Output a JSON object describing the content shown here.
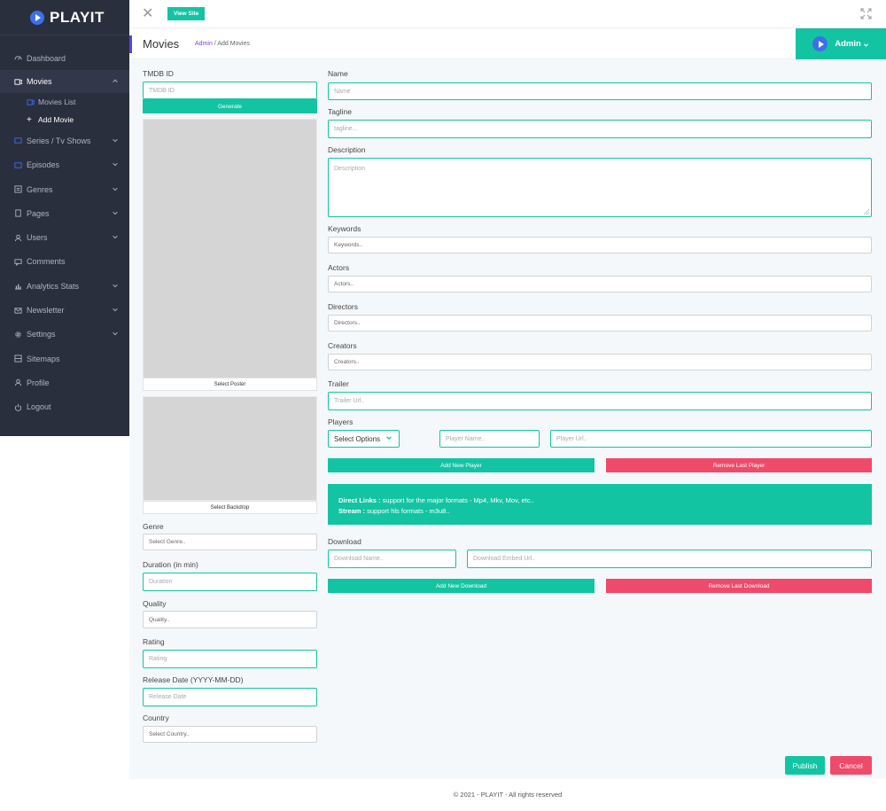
{
  "app": {
    "logo_text": "PLAYIT"
  },
  "sidebar": {
    "items": [
      {
        "label": "Dashboard",
        "icon": "dashboard-icon",
        "chevron": ""
      },
      {
        "label": "Movies",
        "icon": "video-icon",
        "chevron": "^"
      },
      {
        "label": "Series / Tv Shows",
        "icon": "tv-icon",
        "chevron": "v"
      },
      {
        "label": "Episodes",
        "icon": "episodes-icon",
        "chevron": "v"
      },
      {
        "label": "Genres",
        "icon": "genres-icon",
        "chevron": "v"
      },
      {
        "label": "Pages",
        "icon": "pages-icon",
        "chevron": "v"
      },
      {
        "label": "Users",
        "icon": "users-icon",
        "chevron": "v"
      },
      {
        "label": "Comments",
        "icon": "comments-icon",
        "chevron": ""
      },
      {
        "label": "Analytics Stats",
        "icon": "analytics-icon",
        "chevron": "v"
      },
      {
        "label": "Newsletter",
        "icon": "newsletter-icon",
        "chevron": "v"
      },
      {
        "label": "Settings",
        "icon": "gear-icon",
        "chevron": "v"
      },
      {
        "label": "Sitemaps",
        "icon": "sitemap-icon",
        "chevron": ""
      },
      {
        "label": "Profile",
        "icon": "profile-icon",
        "chevron": ""
      },
      {
        "label": "Logout",
        "icon": "power-icon",
        "chevron": ""
      }
    ],
    "movies_sub": [
      {
        "label": "Movies List",
        "icon": "list-icon"
      },
      {
        "label": "Add Movie",
        "icon": "plus-icon"
      }
    ]
  },
  "topbar": {
    "view_site": "View Site"
  },
  "header": {
    "title": "Movies",
    "crumb_root": "Admin",
    "crumb_sep": "/",
    "crumb_current": "Add Movies",
    "user": "Admin"
  },
  "form": {
    "tmdb": {
      "label": "TMDB ID",
      "placeholder": "TMDB ID",
      "generate": "Generate"
    },
    "poster": {
      "caption": "Select Poster"
    },
    "backdrop": {
      "caption": "Select Backdrop"
    },
    "genre": {
      "label": "Genre",
      "placeholder": "Select Genre.."
    },
    "duration": {
      "label": "Duration (in min)",
      "placeholder": "Duration"
    },
    "quality": {
      "label": "Quality",
      "placeholder": "Quality.."
    },
    "rating": {
      "label": "Rating",
      "placeholder": "Rating"
    },
    "release": {
      "label": "Release Date (YYYY-MM-DD)",
      "placeholder": "Release Date"
    },
    "country": {
      "label": "Country",
      "placeholder": "Select Country.."
    },
    "name": {
      "label": "Name",
      "placeholder": "Name"
    },
    "tagline": {
      "label": "Tagline",
      "placeholder": "tagline..."
    },
    "description": {
      "label": "Description",
      "placeholder": "Description"
    },
    "keywords": {
      "label": "Keywords",
      "placeholder": "Keywords.."
    },
    "actors": {
      "label": "Actors",
      "placeholder": "Actors.."
    },
    "directors": {
      "label": "Directors",
      "placeholder": "Directors.."
    },
    "creators": {
      "label": "Creators",
      "placeholder": "Creators.."
    },
    "trailer": {
      "label": "Trailer",
      "placeholder": "Trailer Url.."
    },
    "players": {
      "label": "Players",
      "select": "Select Options",
      "name_placeholder": "Player Name..",
      "url_placeholder": "Player Url..",
      "add": "Add New Player",
      "remove": "Remove Last Player"
    },
    "info": {
      "direct_title": "Direct Links :",
      "direct_text": " support for the major formats - Mp4, Mkv, Mov, etc..",
      "stream_title": "Stream :",
      "stream_text": " support hls formats - m3u8.."
    },
    "download": {
      "label": "Download",
      "name_placeholder": "Download Name..",
      "url_placeholder": "Download Embed Url..",
      "add": "Add New Download",
      "remove": "Remove Last Download"
    },
    "publish": "Publish",
    "cancel": "Cancel"
  },
  "footer": {
    "text": "© 2021 - PLAYIT - All rights reserved"
  },
  "colors": {
    "sidebar_bg": "#2a2f3e",
    "accent": "#13c4a3",
    "danger": "#f04a6a",
    "brand_blue": "#3d6fe8"
  }
}
